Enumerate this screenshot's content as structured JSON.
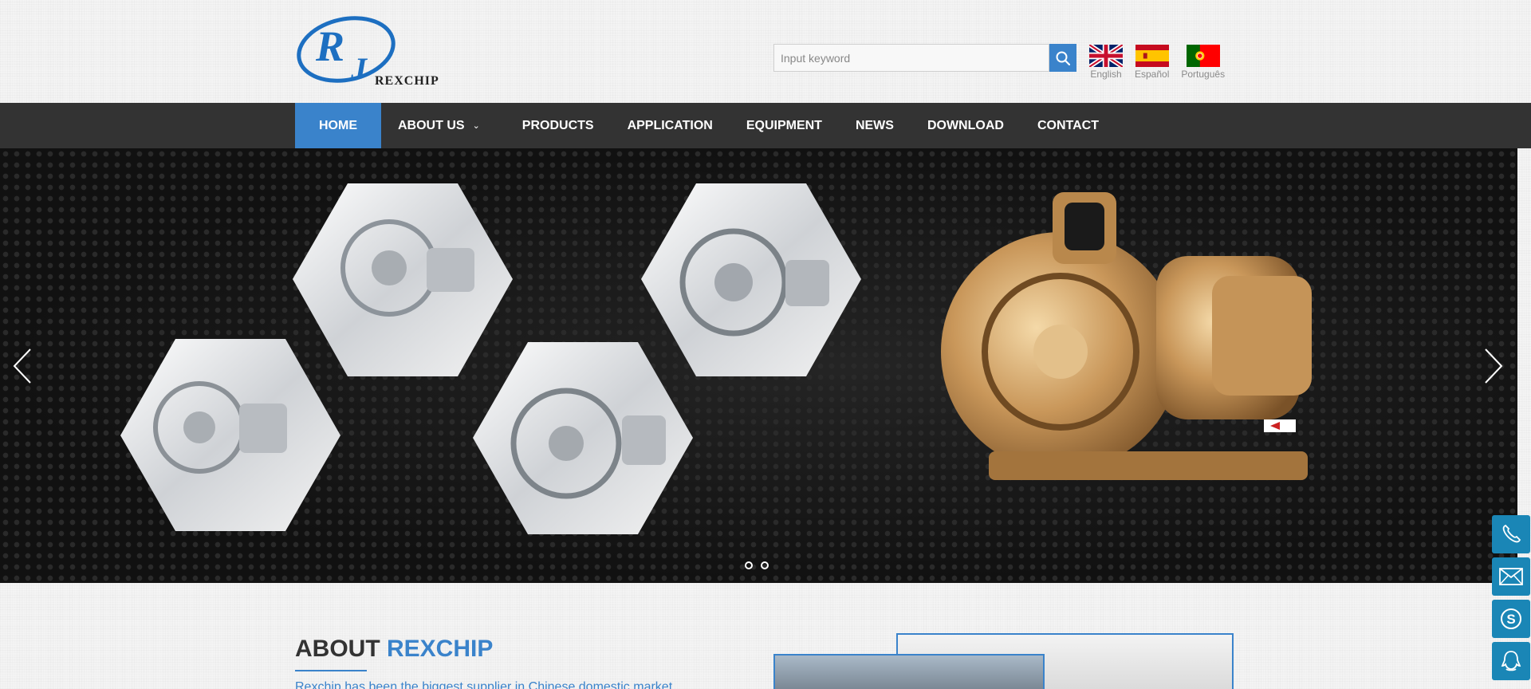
{
  "header": {
    "logo_text": "REXCHIP",
    "logo_monogram": [
      "R",
      "J"
    ],
    "search": {
      "placeholder": "Input keyword",
      "value": ""
    },
    "search_icon": "search-icon",
    "languages": [
      {
        "label": "English",
        "flag": "uk-flag-icon"
      },
      {
        "label": "Español",
        "flag": "spain-flag-icon"
      },
      {
        "label": "Português",
        "flag": "portugal-flag-icon"
      }
    ]
  },
  "nav": {
    "items": [
      {
        "label": "HOME",
        "active": true
      },
      {
        "label": "ABOUT US",
        "dropdown": true
      },
      {
        "label": "PRODUCTS"
      },
      {
        "label": "APPLICATION"
      },
      {
        "label": "EQUIPMENT"
      },
      {
        "label": "NEWS"
      },
      {
        "label": "DOWNLOAD"
      },
      {
        "label": "CONTACT"
      }
    ],
    "caret": "⌄"
  },
  "banner": {
    "slide_count": 2,
    "active_slide": 1
  },
  "side_contact": [
    "phone-icon",
    "mail-icon",
    "skype-icon",
    "qq-icon"
  ],
  "about": {
    "title_plain": "ABOUT",
    "title_accent": "REXCHIP",
    "text": "Rexchip has been the biggest supplier in Chinese domestic market"
  },
  "colors": {
    "accent": "#3a83cb",
    "nav_bg": "#333333",
    "side_button": "#1a86b6"
  }
}
